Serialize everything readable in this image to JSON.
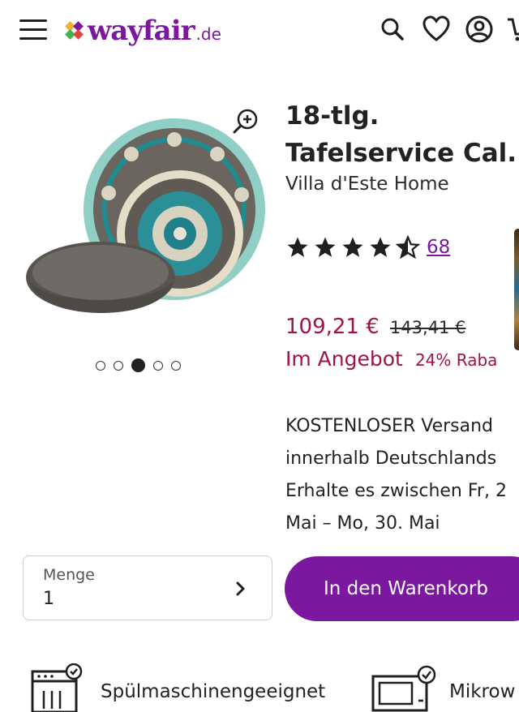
{
  "header": {
    "logo_text": "wayfair",
    "logo_tld": ".de",
    "icons": [
      "menu-icon",
      "search-icon",
      "heart-icon",
      "account-icon",
      "cart-icon"
    ]
  },
  "gallery": {
    "zoom_icon": "zoom-in-icon",
    "slide_count": 5,
    "active_slide": 3
  },
  "product": {
    "title_line1": "18-tlg.",
    "title_line2": "Tafelservice Cal...",
    "brand": "Villa d'Este Home",
    "rating": 4.5,
    "rating_max": 5,
    "review_count": "68",
    "price": "109,21 €",
    "old_price": "143,41 €",
    "sale_label": "Im Angebot",
    "discount": "24% Raba"
  },
  "shipping": {
    "line1": "KOSTENLOSER Versand",
    "line2": "innerhalb Deutschlands",
    "line3": "Erhalte es zwischen Fr, 2",
    "line4": "Mai – Mo, 30. Mai"
  },
  "quantity": {
    "label": "Menge",
    "value": "1"
  },
  "cart_button": {
    "label": "In den Warenkorb"
  },
  "features": [
    {
      "icon": "dishwasher-icon",
      "label": "Spülmaschinengeeignet"
    },
    {
      "icon": "microwave-icon",
      "label": "Mikrow"
    }
  ],
  "colors": {
    "brand": "#7b189f",
    "price": "#a1124b"
  }
}
